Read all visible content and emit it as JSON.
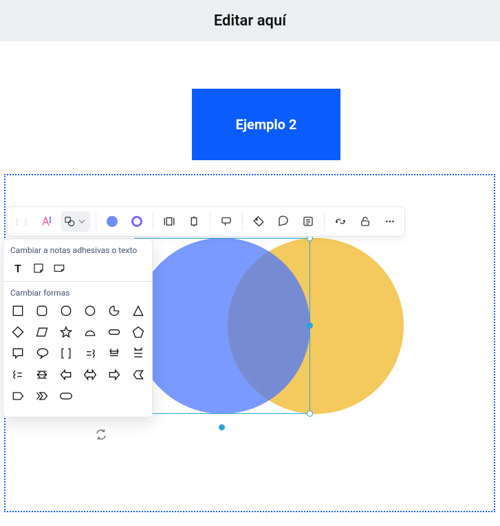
{
  "header": {
    "title": "Editar aquí"
  },
  "canvas": {
    "blue_rect_label": "Ejemplo 2",
    "colors": {
      "accent": "#0b5cff",
      "circle_blue": "#6a8dff",
      "circle_yellow": "#f4c95d"
    }
  },
  "toolbar": {
    "items": [
      {
        "name": "drag-handle",
        "icon": "grip"
      },
      {
        "name": "ai-button",
        "icon": "ai"
      },
      {
        "name": "shape-type-dropdown",
        "icon": "shape"
      },
      {
        "name": "fill-color",
        "icon": "fill"
      },
      {
        "name": "stroke-color",
        "icon": "stroke"
      },
      {
        "name": "align-left",
        "icon": "text-align-left"
      },
      {
        "name": "align-center",
        "icon": "text-align-center"
      },
      {
        "name": "middle-button",
        "icon": "text-note"
      },
      {
        "name": "tag-button",
        "icon": "tag"
      },
      {
        "name": "comment-button",
        "icon": "comment"
      },
      {
        "name": "data-button",
        "icon": "data"
      },
      {
        "name": "link-button",
        "icon": "link"
      },
      {
        "name": "lock-button",
        "icon": "unlock"
      },
      {
        "name": "more-button",
        "icon": "more"
      }
    ]
  },
  "popover": {
    "section1_label": "Cambiar a notas adhesivas o texto",
    "section1_items": [
      {
        "name": "text-tool",
        "icon": "T"
      },
      {
        "name": "sticky-note-small",
        "icon": "sticky-sm"
      },
      {
        "name": "sticky-note-wide",
        "icon": "sticky-lg"
      }
    ],
    "section2_label": "Cambiar formas",
    "shapes": [
      [
        "square",
        "rounded-square",
        "squircle",
        "circle",
        "target",
        "triangle"
      ],
      [
        "diamond",
        "parallelogram",
        "star",
        "semi-arc",
        "stadium",
        "pentagon"
      ],
      [
        "speech-rect",
        "speech-bubble",
        "brackets",
        "brace-equal",
        "struck",
        "overline-eq"
      ],
      [
        "brace-right",
        "double-arrow-both",
        "arrow-left",
        "arrow-leftright",
        "arrow-right",
        "chevron-left"
      ],
      [
        "tag-right",
        "double-chevron",
        "stadium-pill",
        "",
        "",
        ""
      ]
    ]
  }
}
